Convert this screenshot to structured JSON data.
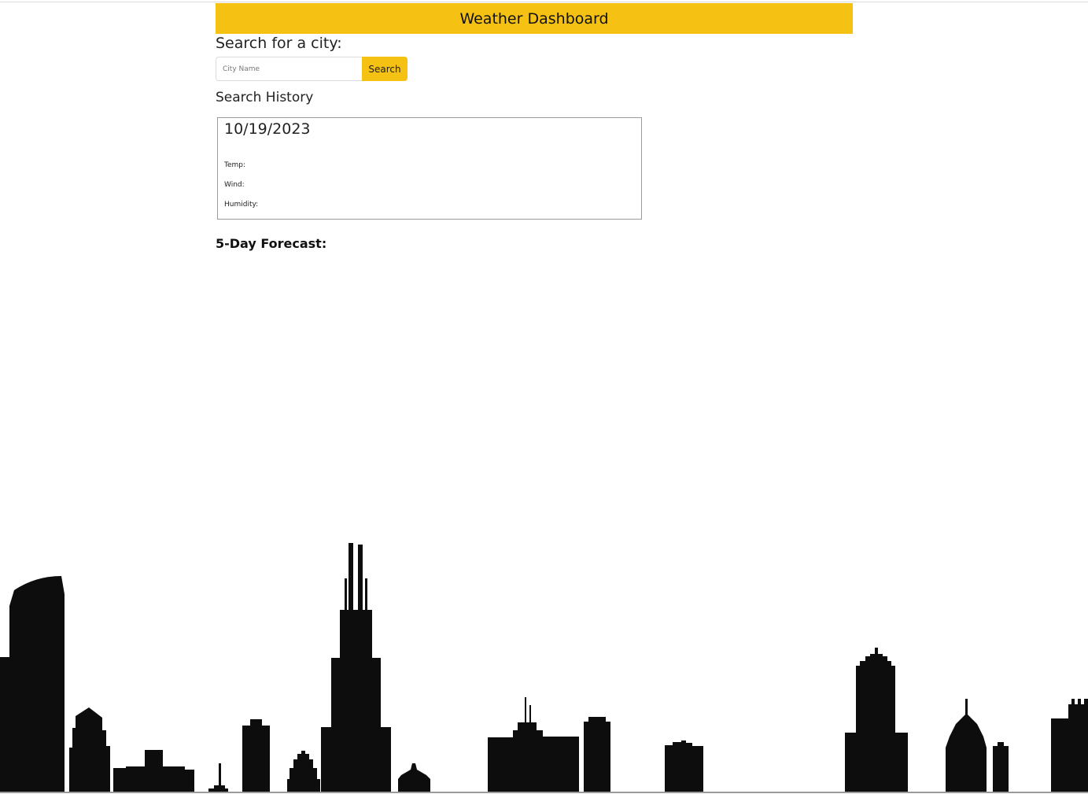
{
  "header": {
    "title": "Weather Dashboard",
    "background": "#f5c113"
  },
  "search": {
    "label": "Search for a city:",
    "placeholder": "City Name",
    "value": "",
    "button_label": "Search"
  },
  "history": {
    "label": "Search History"
  },
  "current": {
    "date": "10/19/2023",
    "temp_label": "Temp:",
    "wind_label": "Wind:",
    "humidity_label": "Humidity:"
  },
  "forecast": {
    "title": "5-Day Forecast:"
  },
  "background": {
    "image": "city-skyline-silhouette",
    "color": "#0d0d0d"
  }
}
